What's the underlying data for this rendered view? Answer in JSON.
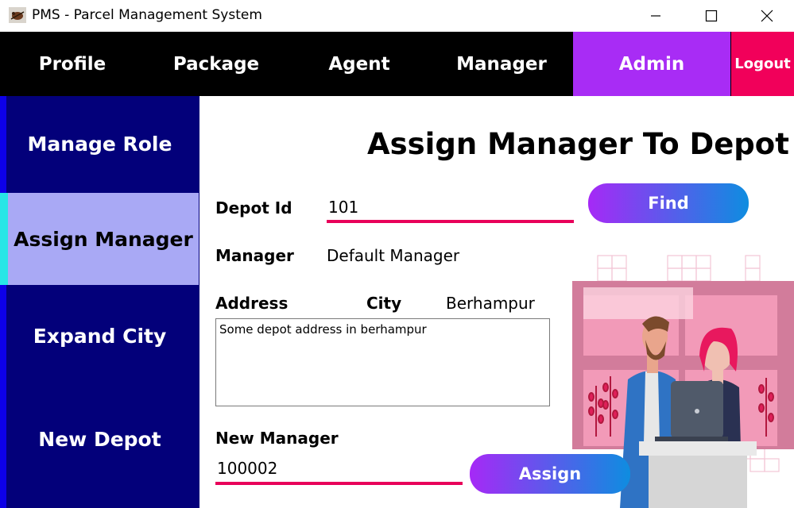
{
  "window": {
    "title": "PMS - Parcel Management System"
  },
  "topnav": {
    "items": [
      {
        "label": "Profile"
      },
      {
        "label": "Package"
      },
      {
        "label": "Agent"
      },
      {
        "label": "Manager"
      },
      {
        "label": "Admin"
      },
      {
        "label": "Logout"
      }
    ],
    "active": "Admin"
  },
  "sidebar": {
    "items": [
      {
        "label": "Manage Role"
      },
      {
        "label": "Assign Manager"
      },
      {
        "label": "Expand City"
      },
      {
        "label": "New Depot"
      }
    ],
    "active": "Assign Manager"
  },
  "main": {
    "title": "Assign Manager To Depot",
    "depot_id_label": "Depot Id",
    "depot_id_value": "101",
    "find_label": "Find",
    "manager_label": "Manager",
    "manager_value": "Default Manager",
    "address_label": "Address",
    "city_label": "City",
    "city_value": "Berhampur",
    "address_value": "Some depot address in berhampur",
    "new_manager_label": "New Manager",
    "new_manager_value": "100002",
    "assign_label": "Assign"
  },
  "colors": {
    "nav_bg": "#000000",
    "admin_bg": "#a82cf5",
    "logout_bg": "#f1005a",
    "sidebar_bg": "#03007a",
    "sidebar_active_bg": "#a9a9f5",
    "input_underline": "#e8005a",
    "button_gradient_start": "#a629f6",
    "button_gradient_end": "#0e8de0"
  }
}
